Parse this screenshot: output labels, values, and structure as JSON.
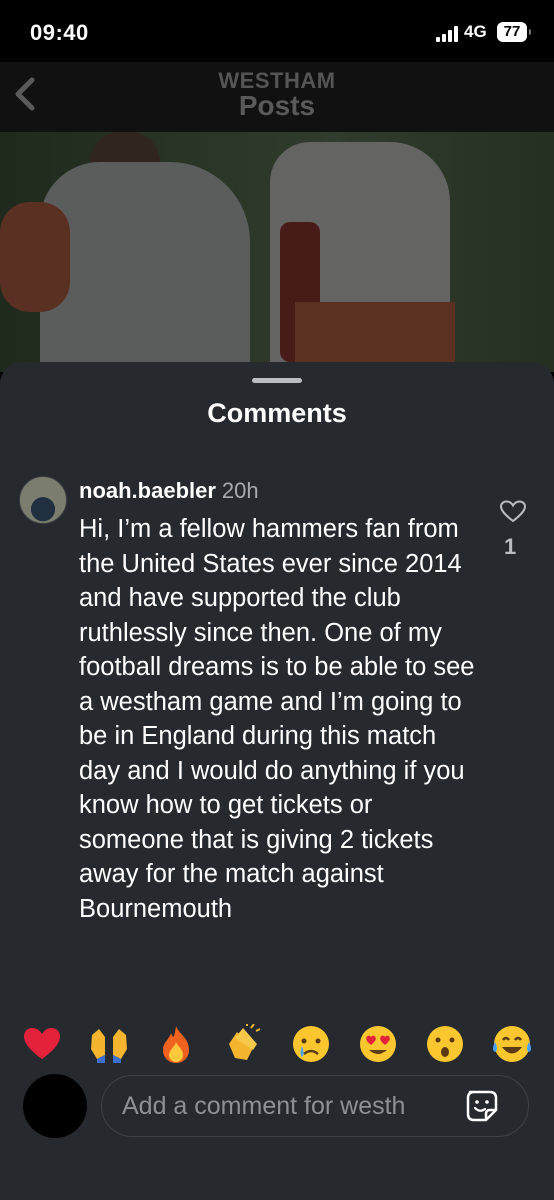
{
  "status_bar": {
    "time": "09:40",
    "network": "4G",
    "battery": "77"
  },
  "header": {
    "subtitle": "WESTHAM",
    "title": "Posts"
  },
  "sheet": {
    "title": "Comments"
  },
  "comment": {
    "username": "noah.baebler",
    "time": "20h",
    "text": "Hi, I’m a fellow hammers fan from the United States ever since 2014 and have supported the club ruthlessly since then. One of my football dreams is to be able to see a westham game and I’m going to be in England during this match day and I would do anything if you know how to get tickets or someone that is giving 2 tickets away for the match against Bournemouth",
    "like_count": "1"
  },
  "emoji_bar": [
    {
      "glyph": "❤️",
      "name": "red-heart"
    },
    {
      "glyph": "🙌",
      "name": "raising-hands"
    },
    {
      "glyph": "🔥",
      "name": "fire"
    },
    {
      "glyph": "👏",
      "name": "clapping-hands"
    },
    {
      "glyph": "😢",
      "name": "crying-face"
    },
    {
      "glyph": "😍",
      "name": "heart-eyes"
    },
    {
      "glyph": "😮",
      "name": "surprised-face"
    },
    {
      "glyph": "😂",
      "name": "tears-of-joy"
    }
  ],
  "composer": {
    "placeholder": "Add a comment for westh"
  },
  "icons": {
    "back": "chevron-left-icon",
    "like": "heart-outline-icon",
    "sticker": "sticker-icon",
    "signal": "signal-bars-icon"
  },
  "colors": {
    "sheet_bg": "#262a2f",
    "like_count": "#b9bcc0",
    "time_muted": "#a7abb0"
  }
}
